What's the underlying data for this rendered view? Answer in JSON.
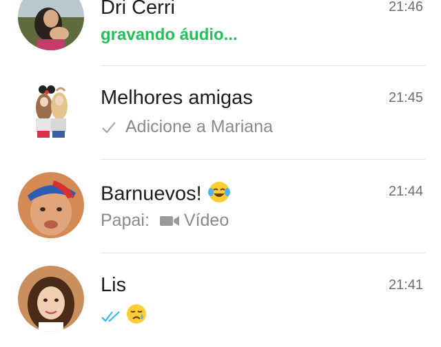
{
  "chats": [
    {
      "name": "Dri Cerri",
      "time": "21:46",
      "status": "gravando áudio...",
      "status_color": "#25c05a"
    },
    {
      "name": "Melhores amigas",
      "time": "21:45",
      "message": "Adicione a Mariana",
      "tick_icon": "single-check-icon"
    },
    {
      "name": "Barnuevos!",
      "name_emoji": "tears-of-joy-emoji",
      "time": "21:44",
      "sender": "Papai:",
      "media_icon": "video-camera-icon",
      "media_label": "Vídeo"
    },
    {
      "name": "Lis",
      "time": "21:41",
      "tick_icon": "double-check-read-icon",
      "tick_color": "#34b7f1",
      "message_emoji": "crying-face-emoji"
    }
  ]
}
